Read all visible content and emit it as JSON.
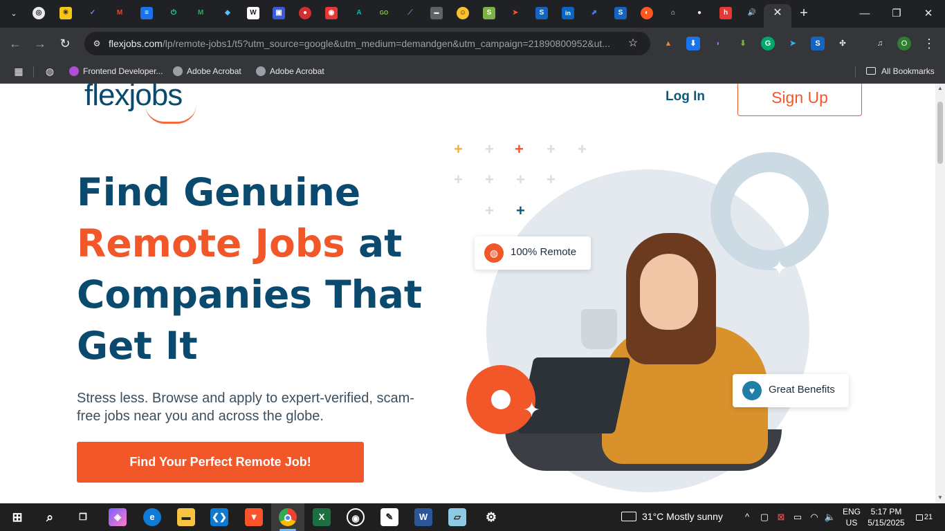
{
  "browser": {
    "tabs_close_label": "✕",
    "new_tab_label": "+",
    "window": {
      "minimize": "—",
      "restore": "❐",
      "close": "✕"
    }
  },
  "toolbar": {
    "back": "←",
    "forward": "→",
    "reload": "↻",
    "url_host": "flexjobs.com",
    "url_path": "/lp/remote-jobs1/t5?utm_source=google&utm_medium=demandgen&utm_campaign=21890800952&ut...",
    "profile_initial": "O"
  },
  "bookmarks": {
    "items": [
      {
        "label": "Frontend Developer...",
        "color": "#b04fd6"
      },
      {
        "label": "Adobe Acrobat",
        "color": "#9aa0a6"
      },
      {
        "label": "Adobe Acrobat",
        "color": "#9aa0a6"
      }
    ],
    "all_bookmarks": "All Bookmarks"
  },
  "page": {
    "logo": "flexjobs",
    "nav": {
      "login": "Log In",
      "signup": "Sign Up"
    },
    "hero": {
      "line1": "Find Genuine",
      "accent": "Remote Jobs",
      "line2_rest": " at",
      "line3": "Companies That",
      "line4": "Get It"
    },
    "subtitle": "Stress less. Browse and apply to expert-verified, scam-free jobs near you and across the globe.",
    "cta": "Find Your Perfect Remote Job!",
    "badges": {
      "remote": "100% Remote",
      "benefits": "Great Benefits"
    }
  },
  "taskbar": {
    "weather": "31°C  Mostly sunny",
    "lang_top": "ENG",
    "lang_bottom": "US",
    "time": "5:17 PM",
    "date": "5/15/2025",
    "notifications": "21"
  },
  "colors": {
    "brand_navy": "#0b4a6f",
    "brand_orange": "#f2572a",
    "ring": "#cbdae3",
    "circle_bg": "#e3e9ee"
  }
}
